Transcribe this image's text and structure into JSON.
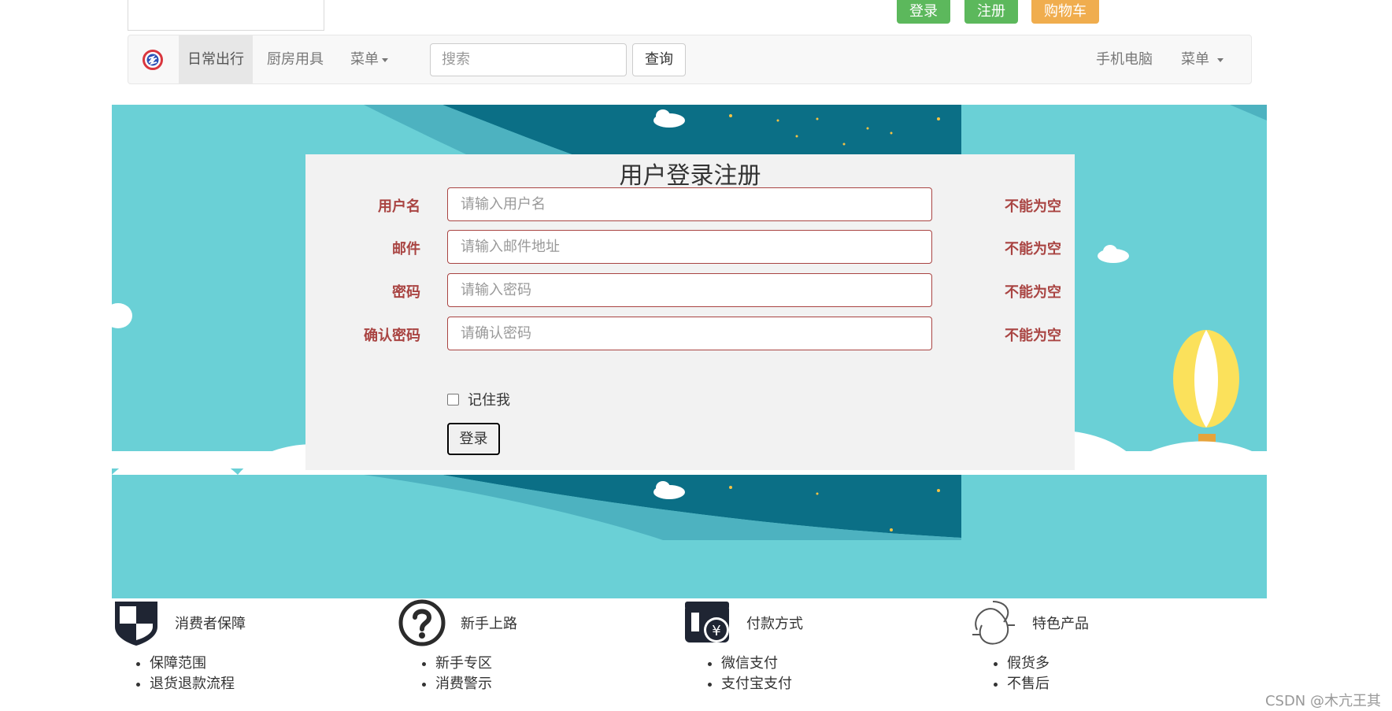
{
  "header": {
    "buttons": {
      "login": "登录",
      "register": "注册",
      "cart": "购物车"
    }
  },
  "navbar": {
    "items": [
      "日常出行",
      "厨房用具",
      "菜单"
    ],
    "search_placeholder": "搜索",
    "search_button": "查询",
    "right_items": [
      "手机电脑",
      "菜单"
    ]
  },
  "form": {
    "title": "用户登录注册",
    "fields": [
      {
        "label": "用户名",
        "placeholder": "请输入用户名",
        "error": "不能为空"
      },
      {
        "label": "邮件",
        "placeholder": "请输入邮件地址",
        "error": "不能为空"
      },
      {
        "label": "密码",
        "placeholder": "请输入密码",
        "error": "不能为空"
      },
      {
        "label": "确认密码",
        "placeholder": "请确认密码",
        "error": "不能为空"
      }
    ],
    "remember_label": "记住我",
    "submit_label": "登录"
  },
  "features": [
    {
      "icon": "shield-icon",
      "title": "消费者保障",
      "items": [
        "保障范围",
        "退货退款流程"
      ]
    },
    {
      "icon": "question-icon",
      "title": "新手上路",
      "items": [
        "新手专区",
        "消费警示"
      ]
    },
    {
      "icon": "wallet-icon",
      "title": "付款方式",
      "items": [
        "微信支付",
        "支付宝支付"
      ]
    },
    {
      "icon": "special-product-icon",
      "title": "特色产品",
      "items": [
        "假货多",
        "不售后"
      ]
    }
  ],
  "watermark": "CSDN @木亢王其",
  "colors": {
    "success": "#5cb85c",
    "warning": "#f0ad4e",
    "error": "#a94442",
    "banner_sky": "#6ad0d6",
    "banner_night": "#066b84"
  }
}
